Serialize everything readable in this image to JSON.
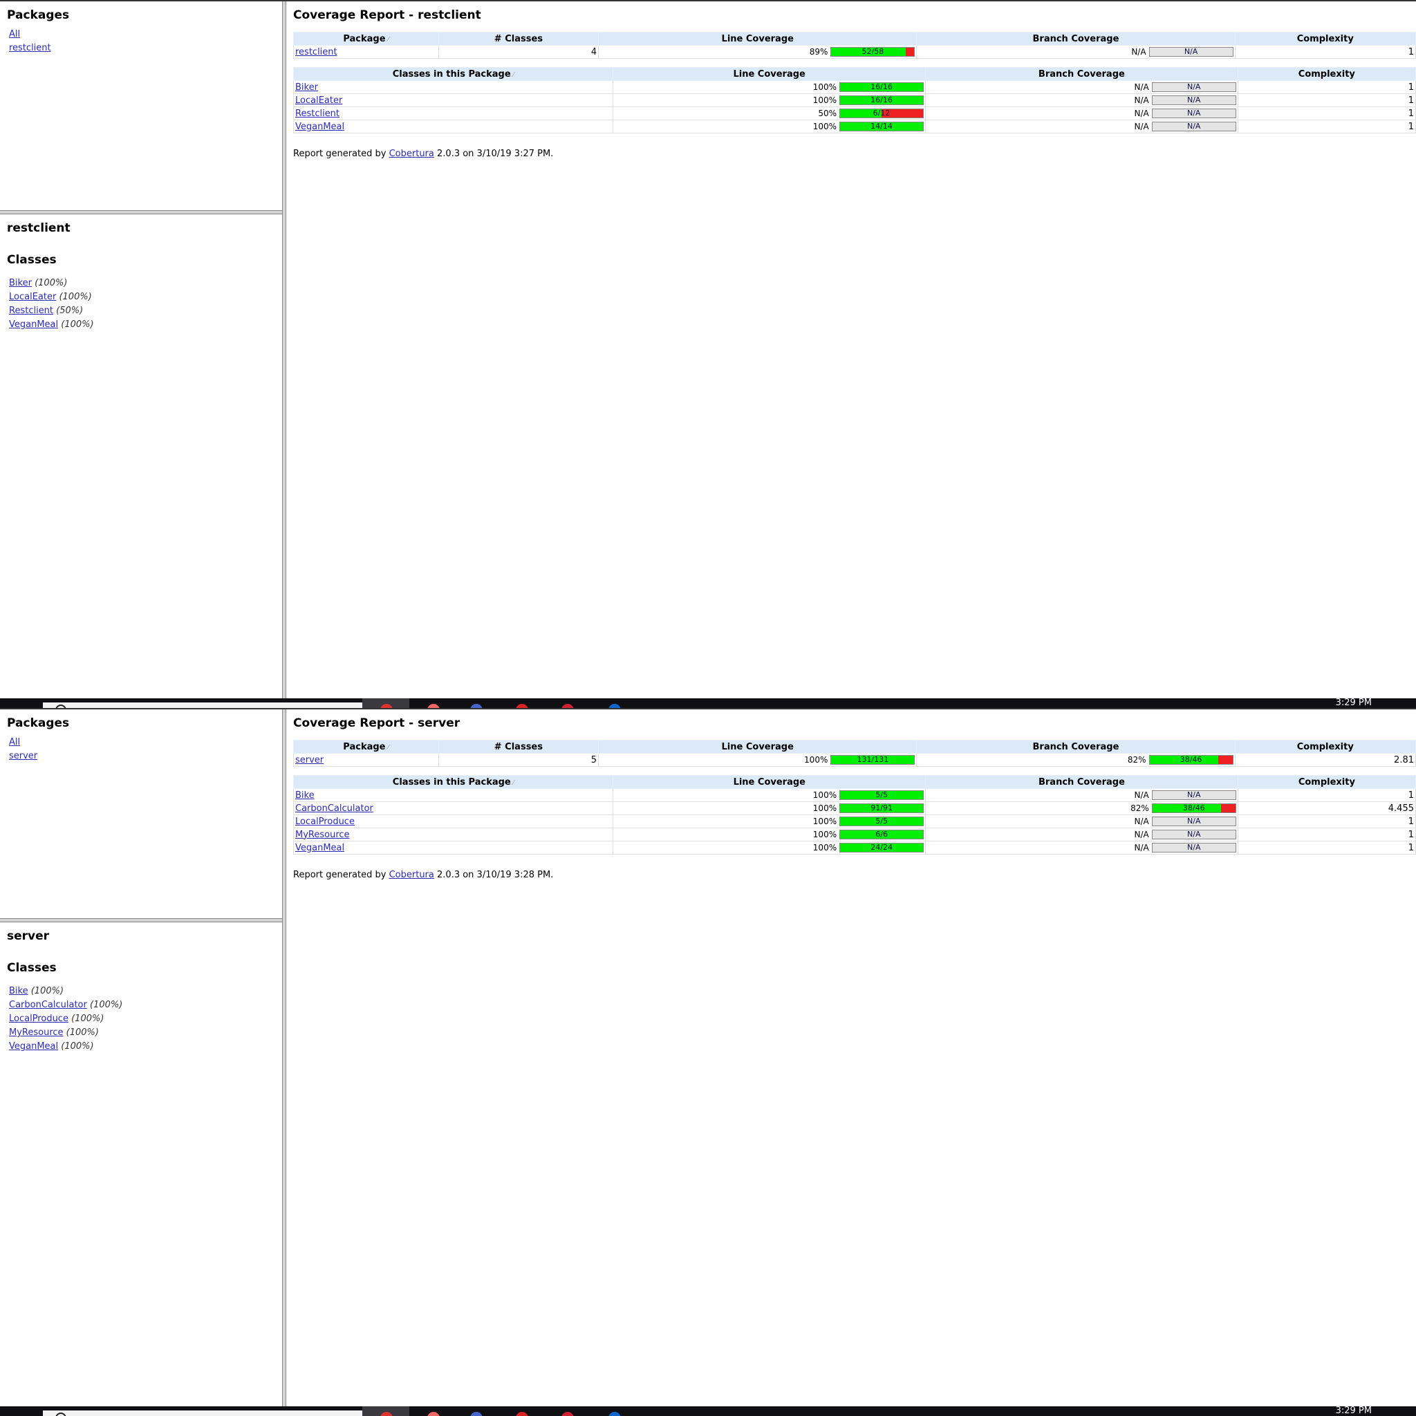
{
  "screens": [
    {
      "packages_heading": "Packages",
      "package_links": [
        "All",
        "restclient"
      ],
      "package_name": "restclient",
      "classes_heading": "Classes",
      "class_links": [
        {
          "name": "Biker",
          "pct": "(100%)"
        },
        {
          "name": "LocalEater",
          "pct": "(100%)"
        },
        {
          "name": "Restclient",
          "pct": "(50%)"
        },
        {
          "name": "VeganMeal",
          "pct": "(100%)"
        }
      ],
      "report_title": "Coverage Report - restclient",
      "pkg_headers": [
        "Package",
        "# Classes",
        "Line Coverage",
        "Branch Coverage",
        "Complexity"
      ],
      "pkg_row": {
        "name": "restclient",
        "classes": "4",
        "line_pct": "89%",
        "line_label": "52/58",
        "line_fraction": 0.8966,
        "branch_pct": "N/A",
        "branch_label": "N/A",
        "branch_fraction": null,
        "complexity": "1"
      },
      "class_headers": [
        "Classes in this Package",
        "Line Coverage",
        "Branch Coverage",
        "Complexity"
      ],
      "class_rows": [
        {
          "name": "Biker",
          "line_pct": "100%",
          "line_label": "16/16",
          "line_fraction": 1,
          "branch_pct": "N/A",
          "branch_label": "N/A",
          "branch_fraction": null,
          "complexity": "1"
        },
        {
          "name": "LocalEater",
          "line_pct": "100%",
          "line_label": "16/16",
          "line_fraction": 1,
          "branch_pct": "N/A",
          "branch_label": "N/A",
          "branch_fraction": null,
          "complexity": "1"
        },
        {
          "name": "Restclient",
          "line_pct": "50%",
          "line_label": "6/12",
          "line_fraction": 0.5,
          "branch_pct": "N/A",
          "branch_label": "N/A",
          "branch_fraction": null,
          "complexity": "1"
        },
        {
          "name": "VeganMeal",
          "line_pct": "100%",
          "line_label": "14/14",
          "line_fraction": 1,
          "branch_pct": "N/A",
          "branch_label": "N/A",
          "branch_fraction": null,
          "complexity": "1"
        }
      ],
      "footer": {
        "prefix": "Report generated by",
        "link": "Cobertura",
        "suffix": "2.0.3 on 3/10/19 3:27 PM."
      },
      "clock": "3:29 PM"
    },
    {
      "packages_heading": "Packages",
      "package_links": [
        "All",
        "server"
      ],
      "package_name": "server",
      "classes_heading": "Classes",
      "class_links": [
        {
          "name": "Bike",
          "pct": "(100%)"
        },
        {
          "name": "CarbonCalculator",
          "pct": "(100%)"
        },
        {
          "name": "LocalProduce",
          "pct": "(100%)"
        },
        {
          "name": "MyResource",
          "pct": "(100%)"
        },
        {
          "name": "VeganMeal",
          "pct": "(100%)"
        }
      ],
      "report_title": "Coverage Report - server",
      "pkg_headers": [
        "Package",
        "# Classes",
        "Line Coverage",
        "Branch Coverage",
        "Complexity"
      ],
      "pkg_row": {
        "name": "server",
        "classes": "5",
        "line_pct": "100%",
        "line_label": "131/131",
        "line_fraction": 1,
        "branch_pct": "82%",
        "branch_label": "38/46",
        "branch_fraction": 0.8261,
        "complexity": "2.81"
      },
      "class_headers": [
        "Classes in this Package",
        "Line Coverage",
        "Branch Coverage",
        "Complexity"
      ],
      "class_rows": [
        {
          "name": "Bike",
          "line_pct": "100%",
          "line_label": "5/5",
          "line_fraction": 1,
          "branch_pct": "N/A",
          "branch_label": "N/A",
          "branch_fraction": null,
          "complexity": "1"
        },
        {
          "name": "CarbonCalculator",
          "line_pct": "100%",
          "line_label": "91/91",
          "line_fraction": 1,
          "branch_pct": "82%",
          "branch_label": "38/46",
          "branch_fraction": 0.8261,
          "complexity": "4.455"
        },
        {
          "name": "LocalProduce",
          "line_pct": "100%",
          "line_label": "5/5",
          "line_fraction": 1,
          "branch_pct": "N/A",
          "branch_label": "N/A",
          "branch_fraction": null,
          "complexity": "1"
        },
        {
          "name": "MyResource",
          "line_pct": "100%",
          "line_label": "6/6",
          "line_fraction": 1,
          "branch_pct": "N/A",
          "branch_label": "N/A",
          "branch_fraction": null,
          "complexity": "1"
        },
        {
          "name": "VeganMeal",
          "line_pct": "100%",
          "line_label": "24/24",
          "line_fraction": 1,
          "branch_pct": "N/A",
          "branch_label": "N/A",
          "branch_fraction": null,
          "complexity": "1"
        }
      ],
      "footer": {
        "prefix": "Report generated by",
        "link": "Cobertura",
        "suffix": "2.0.3 on 3/10/19 3:28 PM."
      },
      "clock": "3:29 PM"
    }
  ],
  "colors": {
    "covered": "#00ee00",
    "missed": "#ee2222",
    "na": "#e4e4e4",
    "header": "#dce9f7",
    "link": "#2a2ab8"
  },
  "icons": [
    "search-icon",
    "taskbar-app-icon"
  ]
}
